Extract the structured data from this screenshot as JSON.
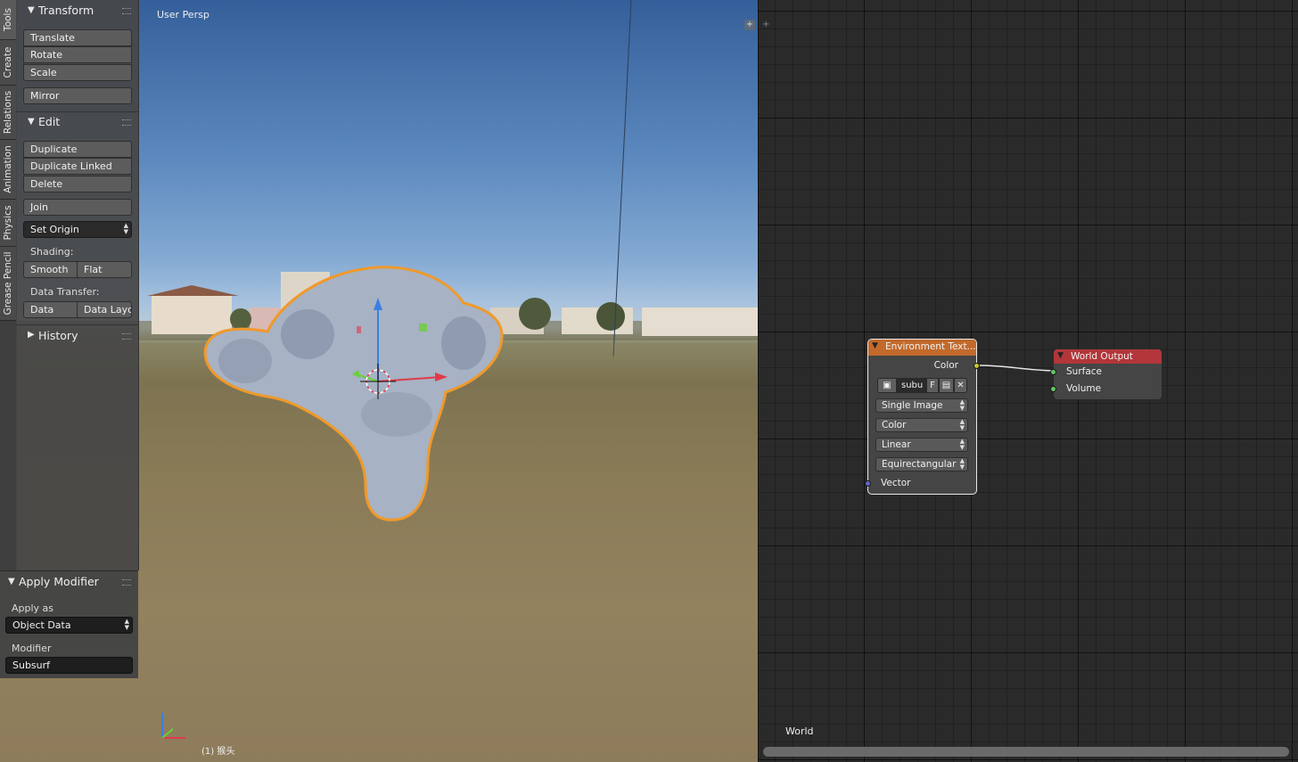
{
  "viewport": {
    "label": "User Persp",
    "status": "(1) 猴头",
    "split_icon": "plus-icon"
  },
  "tabs": [
    "Tools",
    "Create",
    "Relations",
    "Animation",
    "Physics",
    "Grease Pencil"
  ],
  "transform": {
    "title": "Transform",
    "translate": "Translate",
    "rotate": "Rotate",
    "scale": "Scale",
    "mirror": "Mirror"
  },
  "edit": {
    "title": "Edit",
    "duplicate": "Duplicate",
    "duplicate_linked": "Duplicate Linked",
    "delete": "Delete",
    "join": "Join",
    "set_origin": "Set Origin",
    "shading_label": "Shading:",
    "smooth": "Smooth",
    "flat": "Flat",
    "data_transfer_label": "Data Transfer:",
    "data": "Data",
    "data_layo": "Data Layo"
  },
  "history": {
    "title": "History"
  },
  "apply_modifier": {
    "title": "Apply Modifier",
    "apply_as_label": "Apply as",
    "apply_as_value": "Object Data",
    "modifier_label": "Modifier",
    "modifier_value": "Subsurf"
  },
  "node_editor": {
    "context": "World",
    "env_node": {
      "title": "Environment Text...",
      "output": "Color",
      "image_name": "subu",
      "fake_user": "F",
      "projection_source": "Single Image",
      "color_space": "Color",
      "interpolation": "Linear",
      "projection": "Equirectangular",
      "input": "Vector"
    },
    "out_node": {
      "title": "World Output",
      "surface": "Surface",
      "volume": "Volume"
    }
  },
  "colors": {
    "selection_outline": "#f0992a",
    "env_header": "#c26a2c",
    "output_header": "#b2363a",
    "color_socket": "#c7c729",
    "shader_socket": "#63c763",
    "vector_socket": "#6363c7"
  }
}
